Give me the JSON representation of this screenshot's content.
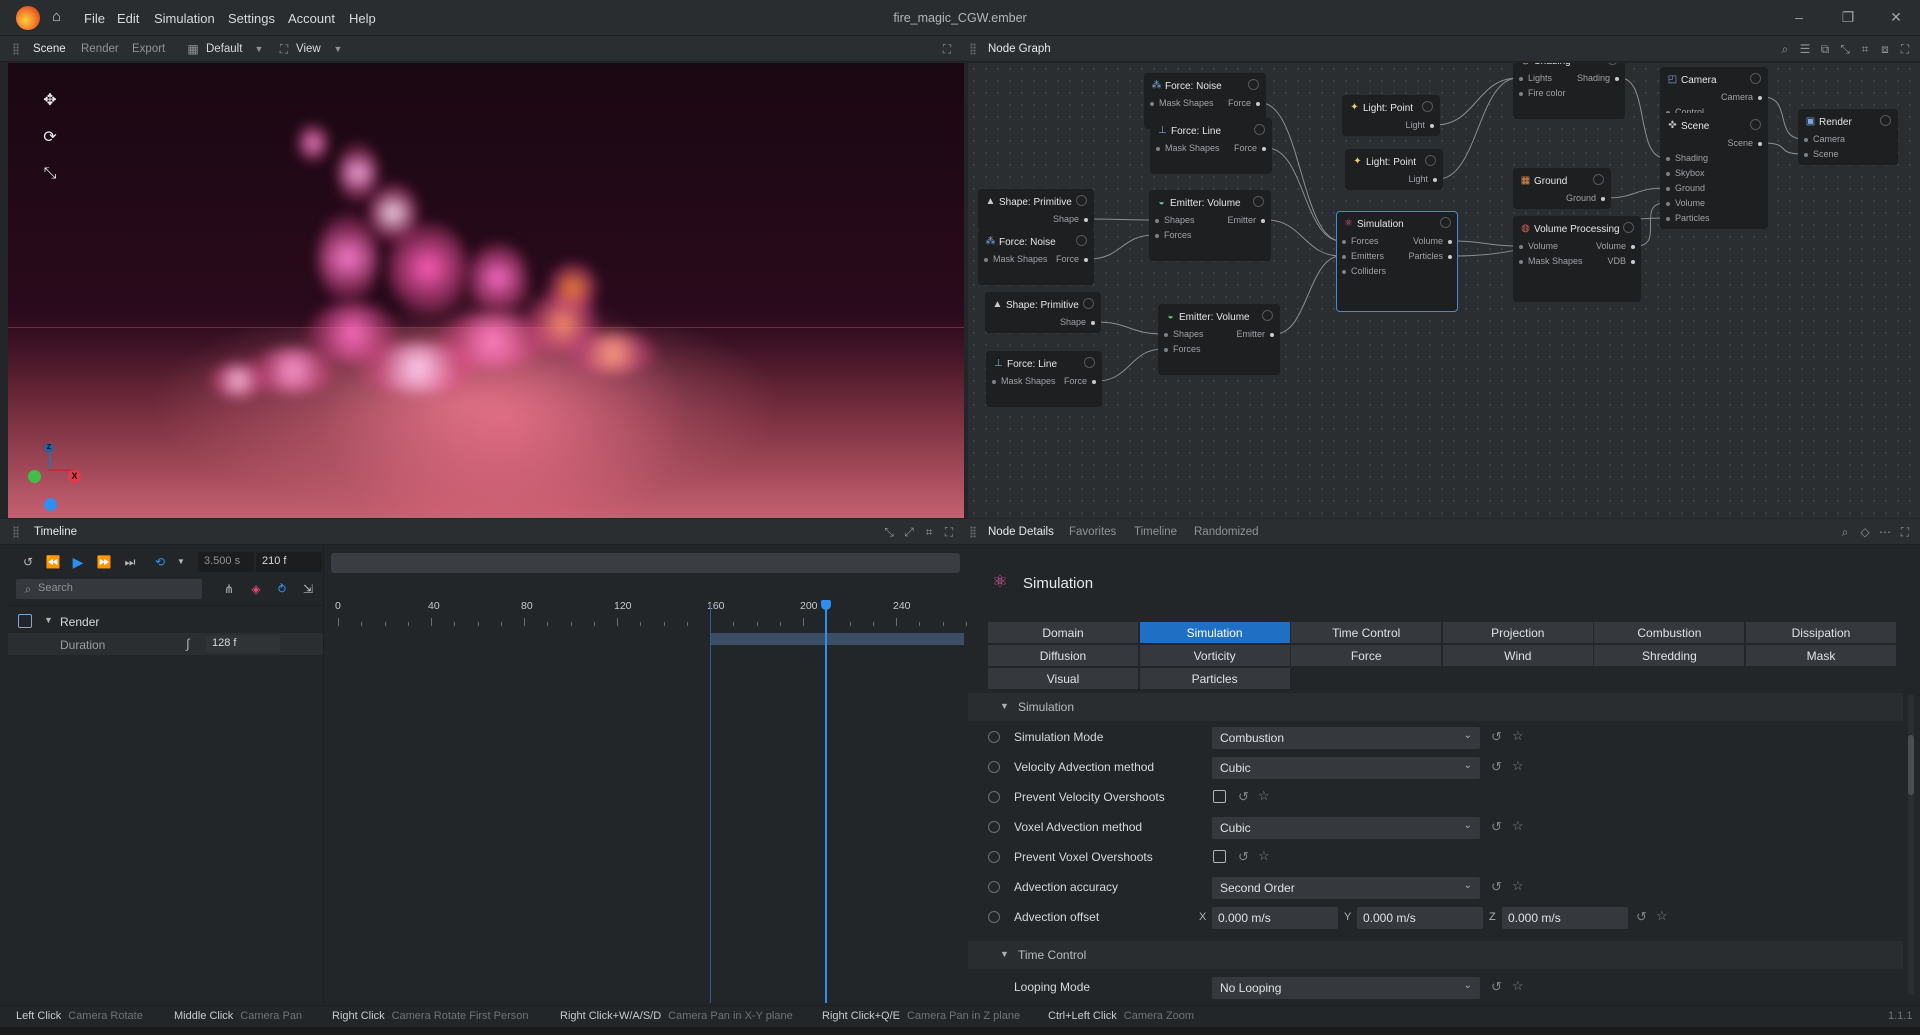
{
  "window": {
    "title": "fire_magic_CGW.ember"
  },
  "menu": [
    "File",
    "Edit",
    "Simulation",
    "Settings",
    "Account",
    "Help"
  ],
  "scene_panel": {
    "tabs": [
      "Scene",
      "Render",
      "Export"
    ],
    "layout_label": "Default",
    "view_label": "View"
  },
  "node_graph": {
    "title": "Node Graph",
    "nodes": [
      {
        "title": "Force: Noise",
        "inputs": [
          "Mask Shapes"
        ],
        "outputs": [
          "Force"
        ]
      },
      {
        "title": "Force: Line",
        "inputs": [
          "Mask Shapes"
        ],
        "outputs": [
          "Force"
        ]
      },
      {
        "title": "Shape: Primitive",
        "inputs": [],
        "outputs": [
          "Shape"
        ]
      },
      {
        "title": "Force: Noise",
        "inputs": [
          "Mask Shapes"
        ],
        "outputs": [
          "Force"
        ]
      },
      {
        "title": "Emitter: Volume",
        "inputs": [
          "Shapes",
          "Forces"
        ],
        "outputs": [
          "Emitter"
        ]
      },
      {
        "title": "Shape: Primitive",
        "inputs": [],
        "outputs": [
          "Shape"
        ]
      },
      {
        "title": "Emitter: Volume",
        "inputs": [
          "Shapes",
          "Forces"
        ],
        "outputs": [
          "Emitter"
        ]
      },
      {
        "title": "Force: Line",
        "inputs": [
          "Mask Shapes"
        ],
        "outputs": [
          "Force"
        ]
      },
      {
        "title": "Light: Point",
        "inputs": [],
        "outputs": [
          "Light"
        ]
      },
      {
        "title": "Light: Point",
        "inputs": [],
        "outputs": [
          "Light"
        ]
      },
      {
        "title": "Simulation",
        "inputs": [
          "Forces",
          "Emitters",
          "Colliders"
        ],
        "outputs": [
          "Volume",
          "Particles"
        ]
      },
      {
        "title": "Shading",
        "inputs": [
          "Lights",
          "Fire color"
        ],
        "outputs": [
          "Shading"
        ]
      },
      {
        "title": "Ground",
        "inputs": [],
        "outputs": [
          "Ground"
        ]
      },
      {
        "title": "Volume Processing",
        "inputs": [
          "Volume",
          "Mask Shapes"
        ],
        "outputs": [
          "Volume",
          "VDB"
        ]
      },
      {
        "title": "Camera",
        "inputs": [
          "Control"
        ],
        "outputs": [
          "Camera"
        ]
      },
      {
        "title": "Scene",
        "inputs": [
          "Shading",
          "Skybox",
          "Ground",
          "Volume",
          "Particles"
        ],
        "outputs": [
          "Scene"
        ]
      },
      {
        "title": "Render",
        "inputs": [
          "Camera",
          "Scene"
        ],
        "outputs": []
      }
    ]
  },
  "timeline": {
    "title": "Timeline",
    "time_value": "3.500 s",
    "frame_value": "210 f",
    "search_placeholder": "Search",
    "tracks": [
      {
        "label": "Render"
      },
      {
        "label": "Duration",
        "value": "128 f"
      }
    ],
    "ruler_ticks": [
      "0",
      "40",
      "80",
      "120",
      "160",
      "200",
      "240"
    ],
    "playhead_frame": 210,
    "range_start_frame": 160
  },
  "details": {
    "tabs": [
      "Node Details",
      "Favorites",
      "Timeline",
      "Randomized"
    ],
    "node_title": "Simulation",
    "categories": [
      "Domain",
      "Simulation",
      "Time Control",
      "Projection",
      "Combustion",
      "Dissipation",
      "Diffusion",
      "Vorticity",
      "Force",
      "Wind",
      "Shredding",
      "Mask",
      "Visual",
      "Particles"
    ],
    "active_category": "Simulation",
    "sections": [
      "Simulation",
      "Time Control"
    ],
    "props": {
      "simulation_mode": {
        "label": "Simulation Mode",
        "value": "Combustion"
      },
      "velocity_advection": {
        "label": "Velocity Advection method",
        "value": "Cubic"
      },
      "prevent_velocity": {
        "label": "Prevent Velocity Overshoots",
        "checked": false
      },
      "voxel_advection": {
        "label": "Voxel Advection method",
        "value": "Cubic"
      },
      "prevent_voxel": {
        "label": "Prevent Voxel Overshoots",
        "checked": false
      },
      "advection_accuracy": {
        "label": "Advection accuracy",
        "value": "Second Order"
      },
      "advection_offset": {
        "label": "Advection offset",
        "x": "0.000 m/s",
        "y": "0.000 m/s",
        "z": "0.000 m/s"
      },
      "looping_mode": {
        "label": "Looping Mode",
        "value": "No Looping"
      }
    },
    "axis_labels": [
      "X",
      "Y",
      "Z"
    ]
  },
  "statusbar": {
    "hints": [
      {
        "key": "Left Click",
        "action": "Camera Rotate"
      },
      {
        "key": "Middle Click",
        "action": "Camera Pan"
      },
      {
        "key": "Right Click",
        "action": "Camera Rotate First Person"
      },
      {
        "key": "Right Click+W/A/S/D",
        "action": "Camera Pan in X-Y plane"
      },
      {
        "key": "Right Click+Q/E",
        "action": "Camera Pan in Z plane"
      },
      {
        "key": "Ctrl+Left Click",
        "action": "Camera Zoom"
      }
    ],
    "version": "1.1.1"
  },
  "colors": {
    "accent": "#1f6fc5",
    "selection_border": "#3f8fd8",
    "fire_core": "#ffd0f0",
    "fire_mid": "#ff5fb8",
    "fire_edge": "#ff8a3a",
    "axis_x": "#e53a4a",
    "axis_y": "#3fbf4a",
    "axis_z": "#2f8ff0"
  },
  "icons": [
    "app-logo",
    "home-icon",
    "move-icon",
    "rotate-icon",
    "scale-icon",
    "play-icon",
    "loop-icon",
    "search-icon",
    "atom-icon"
  ]
}
